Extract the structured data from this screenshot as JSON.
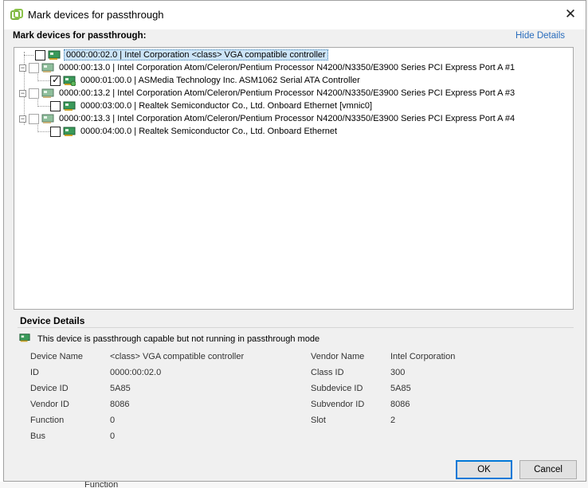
{
  "window": {
    "title": "Mark devices for passthrough"
  },
  "header": {
    "section_label": "Mark devices for passthrough:",
    "hide_details": "Hide Details"
  },
  "tree": {
    "nodes": [
      {
        "text": "0000:00:02.0 | Intel Corporation <class> VGA compatible controller",
        "checked": false,
        "selected": true
      },
      {
        "text": "0000:00:13.0 | Intel Corporation Atom/Celeron/Pentium Processor N4200/N3350/E3900 Series PCI Express Port A #1",
        "checked": false
      },
      {
        "text": "0000:01:00.0 | ASMedia Technology Inc. ASM1062 Serial ATA Controller",
        "checked": true
      },
      {
        "text": "0000:00:13.2 | Intel Corporation Atom/Celeron/Pentium Processor N4200/N3350/E3900 Series PCI Express Port A #3",
        "checked": false
      },
      {
        "text": "0000:03:00.0 | Realtek Semiconductor Co., Ltd. Onboard Ethernet [vmnic0]",
        "checked": false
      },
      {
        "text": "0000:00:13.3 | Intel Corporation Atom/Celeron/Pentium Processor N4200/N3350/E3900 Series PCI Express Port A #4",
        "checked": false
      },
      {
        "text": "0000:04:00.0 | Realtek Semiconductor Co., Ltd. Onboard Ethernet",
        "checked": false
      }
    ]
  },
  "details": {
    "title": "Device Details",
    "status": "This device is passthrough capable but not running in passthrough mode",
    "left": [
      {
        "label": "Device Name",
        "value": "<class> VGA compatible controller"
      },
      {
        "label": "ID",
        "value": "0000:00:02.0"
      },
      {
        "label": "Device ID",
        "value": "5A85"
      },
      {
        "label": "Vendor ID",
        "value": "8086"
      },
      {
        "label": "Function",
        "value": "0"
      },
      {
        "label": "Bus",
        "value": "0"
      }
    ],
    "right": [
      {
        "label": "Vendor Name",
        "value": "Intel Corporation"
      },
      {
        "label": "Class ID",
        "value": "300"
      },
      {
        "label": "Subdevice ID",
        "value": "5A85"
      },
      {
        "label": "Subvendor ID",
        "value": "8086"
      },
      {
        "label": "Slot",
        "value": "2"
      }
    ]
  },
  "buttons": {
    "ok": "OK",
    "cancel": "Cancel"
  },
  "background": {
    "bottom_text": "Function"
  },
  "icons": {
    "app": "vsphere-icon",
    "pci": "pci-card-icon",
    "close": "close-icon"
  },
  "colors": {
    "accent": "#2a6dbd",
    "selection": "#cce4f7",
    "pci_green": "#2e8b57"
  }
}
